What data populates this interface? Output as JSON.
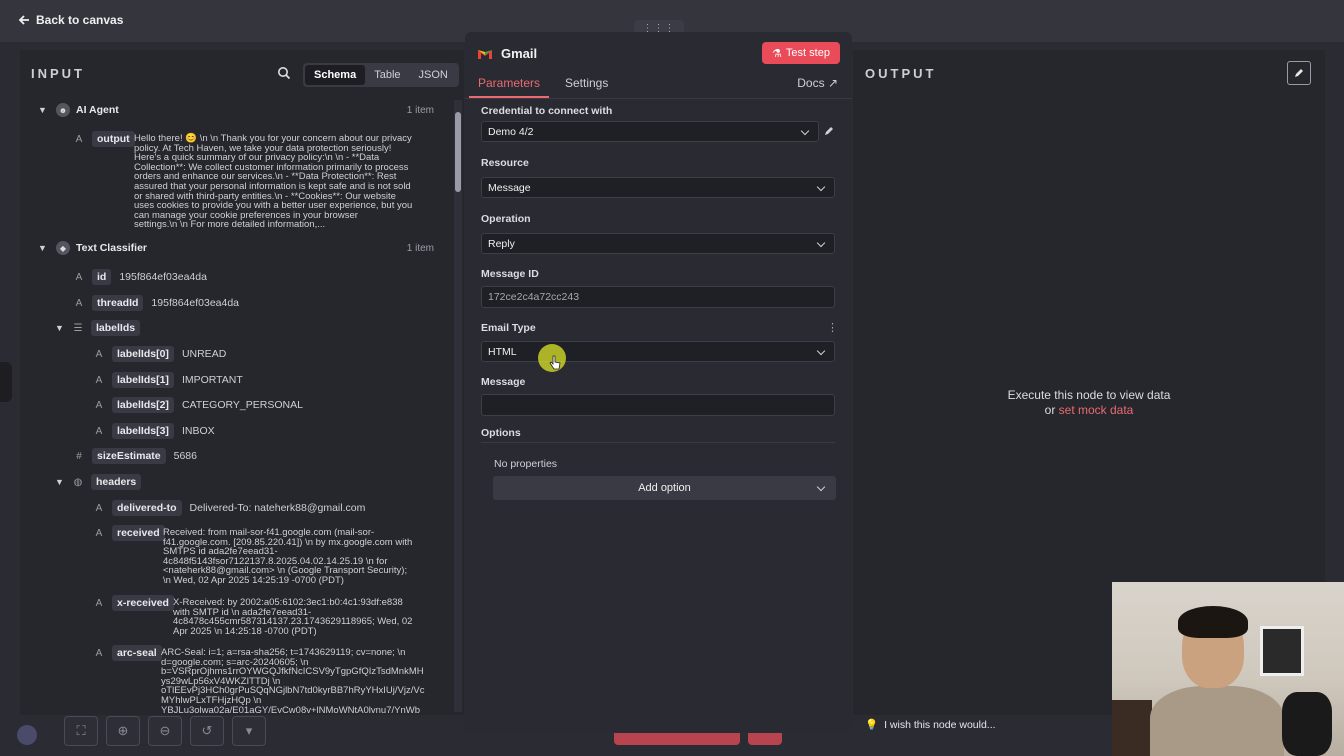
{
  "topbar": {
    "back_label": "Back to canvas"
  },
  "input": {
    "title": "INPUT",
    "views": [
      "Schema",
      "Table",
      "JSON"
    ],
    "ai_agent": {
      "label": "AI Agent",
      "count": "1 item",
      "output_key": "output",
      "output_text": "Hello there! 😊 \\n \\n Thank you for your concern about our privacy\npolicy. At Tech Haven, we take your data protection seriously!\nHere's a quick summary of our privacy policy:\\n \\n - **Data\nCollection**: We collect customer information primarily to process\norders and enhance our services.\\n - **Data Protection**: Rest\nassured that your personal information is kept safe and is not sold\nor shared with third-party entities.\\n - **Cookies**: Our website\nuses cookies to provide you with a better user experience, but you\ncan manage your cookie preferences in your browser\nsettings.\\n \\n For more detailed information,..."
    },
    "text_classifier": {
      "label": "Text Classifier",
      "count": "1 item"
    },
    "id": {
      "key": "id",
      "value": "195f864ef03ea4da"
    },
    "threadId": {
      "key": "threadId",
      "value": "195f864ef03ea4da"
    },
    "labelIds": {
      "key": "labelIds",
      "items": [
        {
          "key": "labelIds[0]",
          "value": "UNREAD"
        },
        {
          "key": "labelIds[1]",
          "value": "IMPORTANT"
        },
        {
          "key": "labelIds[2]",
          "value": "CATEGORY_PERSONAL"
        },
        {
          "key": "labelIds[3]",
          "value": "INBOX"
        }
      ]
    },
    "sizeEstimate": {
      "key": "sizeEstimate",
      "value": "5686"
    },
    "headers": {
      "key": "headers",
      "delivered_to": {
        "key": "delivered-to",
        "value": "Delivered-To: nateherk88@gmail.com"
      },
      "received": {
        "key": "received",
        "value": "Received: from mail-sor-f41.google.com (mail-sor-\nf41.google.com. [209.85.220.41]) \\n by mx.google.com with\nSMTPS id ada2fe7eead31-\n4c848f5143fsor7122137.8.2025.04.02.14.25.19 \\n for\n<nateherk88@gmail.com> \\n (Google Transport Security);\n\\n Wed, 02 Apr 2025 14:25:19 -0700 (PDT)"
      },
      "x_received": {
        "key": "x-received",
        "value": "X-Received: by 2002:a05:6102:3ec1:b0:4c1:93df:e838\nwith SMTP id \\n ada2fe7eead31-\n4c8478c455cmr587314137.23.1743629118965; Wed, 02\nApr 2025 \\n 14:25:18 -0700 (PDT)"
      },
      "arc_seal": {
        "key": "arc-seal",
        "value": "ARC-Seal: i=1; a=rsa-sha256; t=1743629119; cv=none; \\n\nd=google.com; s=arc-20240605; \\n\nb=VSRprOjhms1rrOYWGQJfkfNcICSV9yTgpGfQIzTsdMnkMH\nys29wLp56xV4WKZITTDj \\n\noTlEEvPj3HCh0grPuSQqNGjlbN7td0kyrBB7hRyYHxIUj/Vjz/Vc\nMYhlwPLxTFHjzHQp \\n\nYBJLu3olwa02a/E01aGY/EvCw08v+lNMoWNtA0lvnu7/YnWb"
      }
    }
  },
  "gmail": {
    "title": "Gmail",
    "test_step": "Test step",
    "tabs": [
      "Parameters",
      "Settings"
    ],
    "docs": "Docs",
    "credential": {
      "label": "Credential to connect with",
      "value": "Demo 4/2"
    },
    "resource": {
      "label": "Resource",
      "value": "Message"
    },
    "operation": {
      "label": "Operation",
      "value": "Reply"
    },
    "message_id": {
      "label": "Message ID",
      "value": "172ce2c4a72cc243"
    },
    "email_type": {
      "label": "Email Type",
      "value": "HTML"
    },
    "message": {
      "label": "Message",
      "value": ""
    },
    "options": {
      "label": "Options",
      "no_props": "No properties",
      "add_option": "Add option"
    }
  },
  "output": {
    "title": "OUTPUT",
    "exec_line1": "Execute this node to view data",
    "exec_or": "or",
    "mock_link": "set mock data"
  },
  "footer": {
    "wish": "I wish this node would..."
  },
  "colors": {
    "accent": "#ea6a6f",
    "test_btn": "#ea4b59",
    "panel": "#26262d"
  }
}
